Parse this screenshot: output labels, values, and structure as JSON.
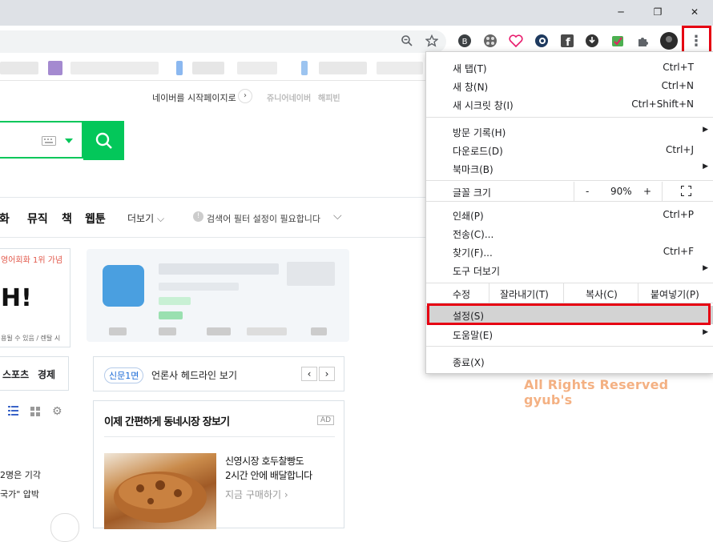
{
  "window": {
    "minimize": "─",
    "restore": "❐",
    "close": "✕"
  },
  "toolbar": {
    "zoom_icon": "magnifier",
    "star_icon": "star",
    "ext_icons": [
      "ext-b",
      "ext-film",
      "heart",
      "ext-edge",
      "facebook",
      "download",
      "ext-check",
      "puzzle"
    ],
    "menu_glyph": "⋮"
  },
  "naver": {
    "startpage": "네이버를 시작페이지로",
    "junior": "쥬니어네이버",
    "happybean": "해피빈",
    "nav": [
      "영화",
      "뮤직",
      "책",
      "웹툰"
    ],
    "more": "더보기",
    "filter_notice": "검색어 필터 설정이 필요합니다",
    "ad_left_top": "영어회화 1위 가념",
    "ad_left_big": "H!",
    "ad_left_small": "용될 수 있음 / 렌탈 시",
    "sports": "스포츠",
    "economy": "경제",
    "news_badge": "신문1면",
    "news_headline": "언론사 헤드라인 보기",
    "shop_title": "이제 간편하게 동네시장 장보기",
    "ad_badge": "AD",
    "product_name_1": "신영시장 호두찰빵도",
    "product_name_2": "2시간 안에 배달합니다",
    "product_cta": "지금 구매하기",
    "left_text_1": "2명은 기각",
    "left_text_2": "국가\" 압박"
  },
  "menu": {
    "new_tab": "새 탭(T)",
    "new_tab_key": "Ctrl+T",
    "new_window": "새 창(N)",
    "new_window_key": "Ctrl+N",
    "incognito": "새 시크릿 창(I)",
    "incognito_key": "Ctrl+Shift+N",
    "history": "방문 기록(H)",
    "downloads": "다운로드(D)",
    "downloads_key": "Ctrl+J",
    "bookmarks": "북마크(B)",
    "font_size": "글꼴 크기",
    "zoom_minus": "-",
    "zoom_value": "90%",
    "zoom_plus": "+",
    "print": "인쇄(P)",
    "print_key": "Ctrl+P",
    "cast": "전송(C)...",
    "find": "찾기(F)...",
    "find_key": "Ctrl+F",
    "more_tools": "도구 더보기",
    "edit": "수정",
    "cut": "잘라내기(T)",
    "copy": "복사(C)",
    "paste": "붙여넣기(P)",
    "settings": "설정(S)",
    "help": "도움말(E)",
    "exit": "종료(X)"
  },
  "watermark": "All Rights Reserved gyub's",
  "colors": {
    "naver_green": "#03c75a",
    "highlight_red": "#e60012"
  }
}
